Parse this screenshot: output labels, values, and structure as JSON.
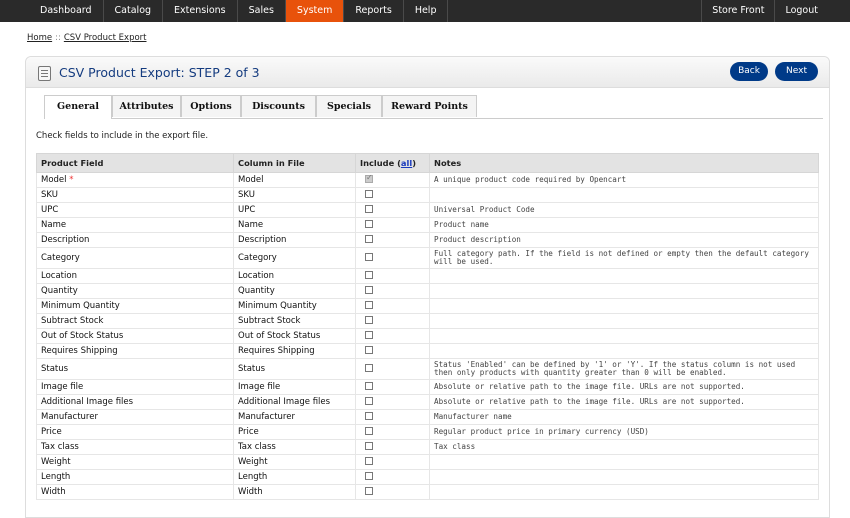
{
  "topnav": {
    "items": [
      "Dashboard",
      "Catalog",
      "Extensions",
      "Sales",
      "System",
      "Reports",
      "Help"
    ],
    "active": "System",
    "right": [
      "Store Front",
      "Logout"
    ]
  },
  "breadcrumb": {
    "home": "Home",
    "sep": "::",
    "current": "CSV Product Export"
  },
  "page": {
    "title": "CSV Product Export: STEP 2 of 3",
    "back": "Back",
    "next": "Next"
  },
  "tabs": [
    "General",
    "Attributes",
    "Options",
    "Discounts",
    "Specials",
    "Reward Points"
  ],
  "hint": "Check fields to include in the export file.",
  "table": {
    "headers": {
      "field": "Product Field",
      "column": "Column in File",
      "include": "Include (",
      "all": "all",
      "include_end": ")",
      "notes": "Notes"
    },
    "rows": [
      {
        "field": "Model",
        "column": "Model",
        "required": "*",
        "checked": true,
        "note": "A unique product code required by Opencart"
      },
      {
        "field": "SKU",
        "column": "SKU",
        "note": ""
      },
      {
        "field": "UPC",
        "column": "UPC",
        "note": "Universal Product Code"
      },
      {
        "field": "Name",
        "column": "Name",
        "note": "Product name"
      },
      {
        "field": "Description",
        "column": "Description",
        "note": "Product description"
      },
      {
        "field": "Category",
        "column": "Category",
        "tall": true,
        "note": "Full category path. If the field is not defined or empty then the default category will be used."
      },
      {
        "field": "Location",
        "column": "Location",
        "note": ""
      },
      {
        "field": "Quantity",
        "column": "Quantity",
        "note": ""
      },
      {
        "field": "Minimum Quantity",
        "column": "Minimum Quantity",
        "note": ""
      },
      {
        "field": "Subtract Stock",
        "column": "Subtract Stock",
        "note": ""
      },
      {
        "field": "Out of Stock Status",
        "column": "Out of Stock Status",
        "note": ""
      },
      {
        "field": "Requires Shipping",
        "column": "Requires Shipping",
        "note": ""
      },
      {
        "field": "Status",
        "column": "Status",
        "tall": true,
        "note": "Status 'Enabled' can be defined by '1' or 'Y'. If the status column is not used then only products with quantity greater than 0 will be enabled."
      },
      {
        "field": "Image file",
        "column": "Image file",
        "note": "Absolute or relative path to the image file. URLs are not supported."
      },
      {
        "field": "Additional Image files",
        "column": "Additional Image files",
        "note": "Absolute or relative path to the image file. URLs are not supported."
      },
      {
        "field": "Manufacturer",
        "column": "Manufacturer",
        "note": "Manufacturer name"
      },
      {
        "field": "Price",
        "column": "Price",
        "note": "Regular product price in primary currency (USD)"
      },
      {
        "field": "Tax class",
        "column": "Tax class",
        "note": "Tax class"
      },
      {
        "field": "Weight",
        "column": "Weight",
        "note": ""
      },
      {
        "field": "Length",
        "column": "Length",
        "note": ""
      },
      {
        "field": "Width",
        "column": "Width",
        "note": ""
      }
    ]
  },
  "colors": {
    "active_nav": "#e8520b",
    "button": "#003a88",
    "title": "#143b7f"
  }
}
